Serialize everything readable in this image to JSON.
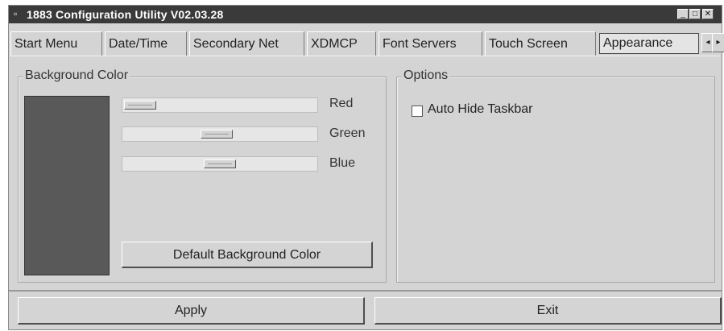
{
  "window": {
    "title": "1883 Configuration Utility V02.03.28",
    "title_icon": "app-icon",
    "controls": {
      "minimize": "minimize-icon",
      "maximize": "maximize-icon",
      "close": "close-icon"
    }
  },
  "tabs": [
    {
      "label": "Start Menu",
      "active": false
    },
    {
      "label": "Date/Time",
      "active": false
    },
    {
      "label": "Secondary Net",
      "active": false
    },
    {
      "label": "XDMCP",
      "active": false
    },
    {
      "label": "Font Servers",
      "active": false
    },
    {
      "label": "Touch Screen",
      "active": false
    },
    {
      "label": "Appearance",
      "active": true
    }
  ],
  "tab_scroll_icons": [
    "arrow-left-icon",
    "arrow-right-icon"
  ],
  "background_color": {
    "group_title": "Background Color",
    "swatch_color": "#595959",
    "sliders": [
      {
        "label": "Red",
        "value_fraction": 0.0
      },
      {
        "label": "Green",
        "value_fraction": 0.48
      },
      {
        "label": "Blue",
        "value_fraction": 0.5
      }
    ],
    "default_button": "Default Background Color"
  },
  "options": {
    "group_title": "Options",
    "auto_hide_taskbar": {
      "label": "Auto Hide Taskbar",
      "checked": false
    }
  },
  "footer": {
    "apply_label": "Apply",
    "exit_label": "Exit"
  }
}
